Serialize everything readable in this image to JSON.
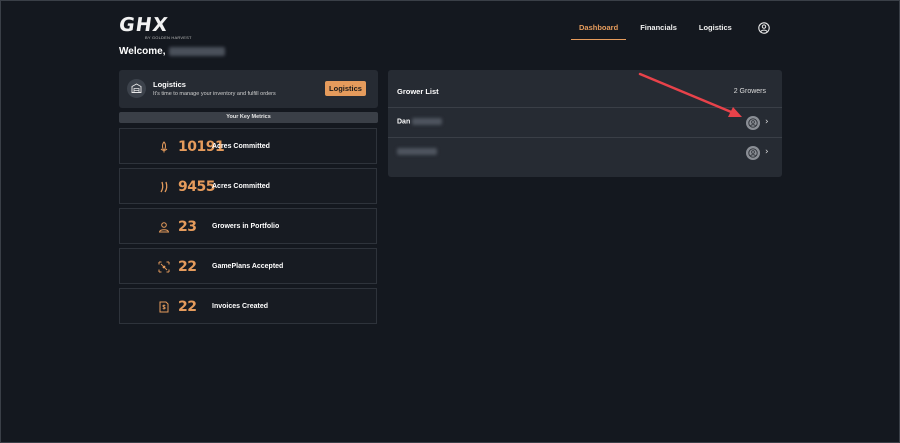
{
  "brand": {
    "logo": "GHX",
    "tagline": "BY GOLDEN HARVEST"
  },
  "welcome": {
    "text": "Welcome,"
  },
  "nav": {
    "dashboard": "Dashboard",
    "financials": "Financials",
    "logistics": "Logistics"
  },
  "logistics_card": {
    "title": "Logistics",
    "description": "It's time to manage your inventory and fulfill orders",
    "button": "Logistics"
  },
  "metrics": {
    "header": "Your Key Metrics",
    "items": [
      {
        "value": "10191",
        "label": "Acres Committed",
        "icon": "corn-icon"
      },
      {
        "value": "9455",
        "label": "Acres Committed",
        "icon": "soybean-icon"
      },
      {
        "value": "23",
        "label": "Growers in Portfolio",
        "icon": "person-icon"
      },
      {
        "value": "22",
        "label": "GamePlans Accepted",
        "icon": "gameplan-icon"
      },
      {
        "value": "22",
        "label": "Invoices Created",
        "icon": "invoice-icon"
      }
    ]
  },
  "grower_list": {
    "title": "Grower List",
    "count": "2 Growers",
    "rows": [
      {
        "name": "Dan"
      },
      {
        "name": ""
      }
    ]
  },
  "colors": {
    "accent": "#e59b5c",
    "annotation_arrow": "#e8424a",
    "background": "#14181f",
    "card": "#262b33"
  }
}
